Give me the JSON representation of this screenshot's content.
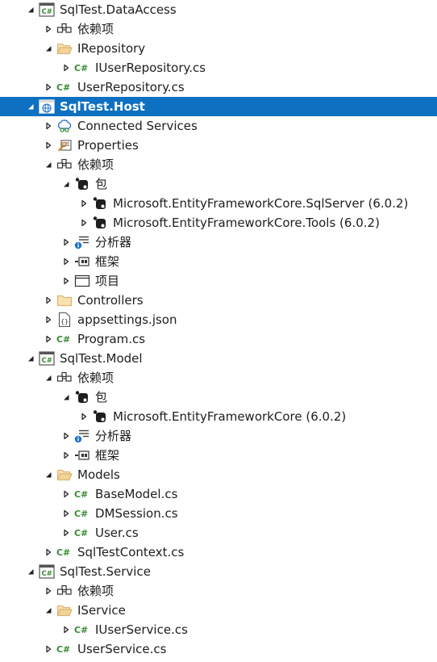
{
  "colors": {
    "selected_bg": "#0e70c0",
    "csharp_green": "#388a34",
    "folder_tan": "#dcb67a",
    "project_box": "#555555",
    "dependency_blue": "#1e6fcf"
  },
  "tree": [
    {
      "label": "SqlTest.DataAccess",
      "depth": 0,
      "expander": "expanded",
      "icon": "csharp-project-icon",
      "kind": "project"
    },
    {
      "label": "依赖项",
      "depth": 1,
      "expander": "collapsed",
      "icon": "dependencies-icon",
      "kind": "dependencies"
    },
    {
      "label": "IRepository",
      "depth": 1,
      "expander": "expanded",
      "icon": "folder-open-icon",
      "kind": "folder"
    },
    {
      "label": "IUserRepository.cs",
      "depth": 2,
      "expander": "collapsed",
      "icon": "csharp-file-icon",
      "kind": "file"
    },
    {
      "label": "UserRepository.cs",
      "depth": 1,
      "expander": "collapsed",
      "icon": "csharp-file-icon",
      "kind": "file"
    },
    {
      "label": "SqlTest.Host",
      "depth": 0,
      "expander": "expanded",
      "icon": "web-project-icon",
      "kind": "project",
      "selected": true
    },
    {
      "label": "Connected Services",
      "depth": 1,
      "expander": "collapsed",
      "icon": "connected-services-icon",
      "kind": "node"
    },
    {
      "label": "Properties",
      "depth": 1,
      "expander": "collapsed",
      "icon": "properties-icon",
      "kind": "node"
    },
    {
      "label": "依赖项",
      "depth": 1,
      "expander": "expanded",
      "icon": "dependencies-icon",
      "kind": "dependencies"
    },
    {
      "label": "包",
      "depth": 2,
      "expander": "expanded",
      "icon": "package-icon",
      "kind": "node"
    },
    {
      "label": "Microsoft.EntityFrameworkCore.SqlServer (6.0.2)",
      "depth": 3,
      "expander": "collapsed",
      "icon": "package-icon",
      "kind": "package"
    },
    {
      "label": "Microsoft.EntityFrameworkCore.Tools (6.0.2)",
      "depth": 3,
      "expander": "collapsed",
      "icon": "package-icon",
      "kind": "package"
    },
    {
      "label": "分析器",
      "depth": 2,
      "expander": "collapsed",
      "icon": "analyzer-icon",
      "kind": "node"
    },
    {
      "label": "框架",
      "depth": 2,
      "expander": "collapsed",
      "icon": "framework-icon",
      "kind": "node"
    },
    {
      "label": "项目",
      "depth": 2,
      "expander": "collapsed",
      "icon": "project-reference-icon",
      "kind": "node"
    },
    {
      "label": "Controllers",
      "depth": 1,
      "expander": "collapsed",
      "icon": "folder-icon",
      "kind": "folder"
    },
    {
      "label": "appsettings.json",
      "depth": 1,
      "expander": "collapsed",
      "icon": "json-file-icon",
      "kind": "file"
    },
    {
      "label": "Program.cs",
      "depth": 1,
      "expander": "collapsed",
      "icon": "csharp-file-icon",
      "kind": "file"
    },
    {
      "label": "SqlTest.Model",
      "depth": 0,
      "expander": "expanded",
      "icon": "csharp-project-icon",
      "kind": "project"
    },
    {
      "label": "依赖项",
      "depth": 1,
      "expander": "expanded",
      "icon": "dependencies-icon",
      "kind": "dependencies"
    },
    {
      "label": "包",
      "depth": 2,
      "expander": "expanded",
      "icon": "package-icon",
      "kind": "node"
    },
    {
      "label": "Microsoft.EntityFrameworkCore (6.0.2)",
      "depth": 3,
      "expander": "collapsed",
      "icon": "package-icon",
      "kind": "package"
    },
    {
      "label": "分析器",
      "depth": 2,
      "expander": "collapsed",
      "icon": "analyzer-icon",
      "kind": "node"
    },
    {
      "label": "框架",
      "depth": 2,
      "expander": "collapsed",
      "icon": "framework-icon",
      "kind": "node"
    },
    {
      "label": "Models",
      "depth": 1,
      "expander": "expanded",
      "icon": "folder-open-icon",
      "kind": "folder"
    },
    {
      "label": "BaseModel.cs",
      "depth": 2,
      "expander": "collapsed",
      "icon": "csharp-file-icon",
      "kind": "file"
    },
    {
      "label": "DMSession.cs",
      "depth": 2,
      "expander": "collapsed",
      "icon": "csharp-file-icon",
      "kind": "file"
    },
    {
      "label": "User.cs",
      "depth": 2,
      "expander": "collapsed",
      "icon": "csharp-file-icon",
      "kind": "file"
    },
    {
      "label": "SqlTestContext.cs",
      "depth": 1,
      "expander": "collapsed",
      "icon": "csharp-file-icon",
      "kind": "file"
    },
    {
      "label": "SqlTest.Service",
      "depth": 0,
      "expander": "expanded",
      "icon": "csharp-project-icon",
      "kind": "project"
    },
    {
      "label": "依赖项",
      "depth": 1,
      "expander": "collapsed",
      "icon": "dependencies-icon",
      "kind": "dependencies"
    },
    {
      "label": "IService",
      "depth": 1,
      "expander": "expanded",
      "icon": "folder-open-icon",
      "kind": "folder"
    },
    {
      "label": "IUserService.cs",
      "depth": 2,
      "expander": "collapsed",
      "icon": "csharp-file-icon",
      "kind": "file"
    },
    {
      "label": "UserService.cs",
      "depth": 1,
      "expander": "collapsed",
      "icon": "csharp-file-icon",
      "kind": "file"
    }
  ]
}
